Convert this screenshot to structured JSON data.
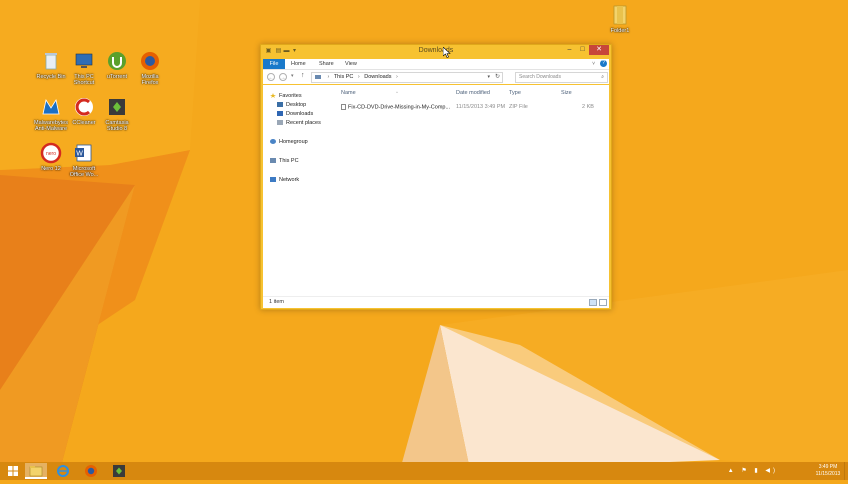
{
  "desktop": {
    "icons": [
      {
        "label": "Recycle Bin",
        "icon": "recycle-bin-icon"
      },
      {
        "label": "This PC\nShortcut",
        "icon": "this-pc-icon"
      },
      {
        "label": "uTorrent",
        "icon": "utorrent-icon"
      },
      {
        "label": "Mozilla\nFirefox",
        "icon": "firefox-icon"
      },
      {
        "label": "Malwarebytes\nAnti-Malware",
        "icon": "malwarebytes-icon"
      },
      {
        "label": "CCleaner",
        "icon": "ccleaner-icon"
      },
      {
        "label": "Camtasia\nStudio 8",
        "icon": "camtasia-icon"
      },
      {
        "label": "Nero 12",
        "icon": "nero-icon"
      },
      {
        "label": "Microsoft\nOffice Wo...",
        "icon": "word-icon"
      },
      {
        "label": "Folder1",
        "icon": "folder-icon"
      }
    ]
  },
  "window": {
    "title": "Downloads",
    "quick_access": [
      "save-icon",
      "folder-icon",
      "undo-icon",
      "dropdown-icon"
    ],
    "controls": {
      "minimize": "–",
      "maximize": "□",
      "close": "✕"
    }
  },
  "ribbon": {
    "tabs": [
      "File",
      "Home",
      "Share",
      "View"
    ],
    "expand_glyph": "˅",
    "help_glyph": "?"
  },
  "address": {
    "back": "←",
    "forward": "→",
    "recent": "▾",
    "up": "↑",
    "path": [
      "This PC",
      "Downloads"
    ],
    "separator": "›",
    "search_placeholder": "Search Downloads"
  },
  "navpane": {
    "favorites": "Favorites",
    "favorite_items": [
      "Desktop",
      "Downloads",
      "Recent places"
    ],
    "homegroup": "Homegroup",
    "this_pc": "This PC",
    "network": "Network"
  },
  "filelist": {
    "columns": [
      "Name",
      "Date modified",
      "Type",
      "Size"
    ],
    "sort_glyph": "^",
    "rows": [
      {
        "name": "Fix-CD-DVD-Drive-Missing-in-My-Comp...",
        "date": "11/15/2013 3:49 PM",
        "type": "ZIP File",
        "size": "2 KB"
      }
    ]
  },
  "status": {
    "count": "1 item"
  },
  "taskbar": {
    "apps": [
      "windows-start-icon",
      "file-explorer-icon",
      "internet-explorer-icon",
      "firefox-icon",
      "camtasia-icon"
    ],
    "tray": "▲ ⚑ ▮ ◀)",
    "time": "3:49 PM",
    "date": "11/15/2013"
  },
  "colors": {
    "wallpaper": "#f5a81c",
    "window_frame": "#f7c231",
    "accent": "#1979ca",
    "taskbar": "#d7880f",
    "close": "#c7463a"
  }
}
